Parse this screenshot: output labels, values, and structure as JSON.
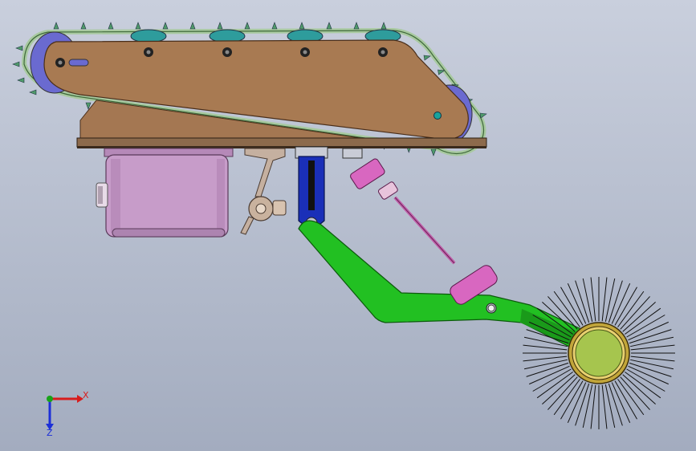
{
  "view": {
    "background_top": "#c9cfdd",
    "background_bottom": "#a3acbf"
  },
  "triad": {
    "x_label": "X",
    "z_label": "Z",
    "x_color": "#d81c1c",
    "y_color": "#19a319",
    "z_color": "#1c2fd8"
  },
  "colors": {
    "track_frame": "#a87a52",
    "track_belt": "#a8c9a0",
    "roller_wheel": "#2e9c9c",
    "idler_wheel": "#6a6ad0",
    "motor_box": "#c79cc9",
    "vertical_slide": "#1a2fb8",
    "swing_arm": "#22c022",
    "actuator": "#d867c0",
    "brush_hub": "#a6c54e"
  }
}
